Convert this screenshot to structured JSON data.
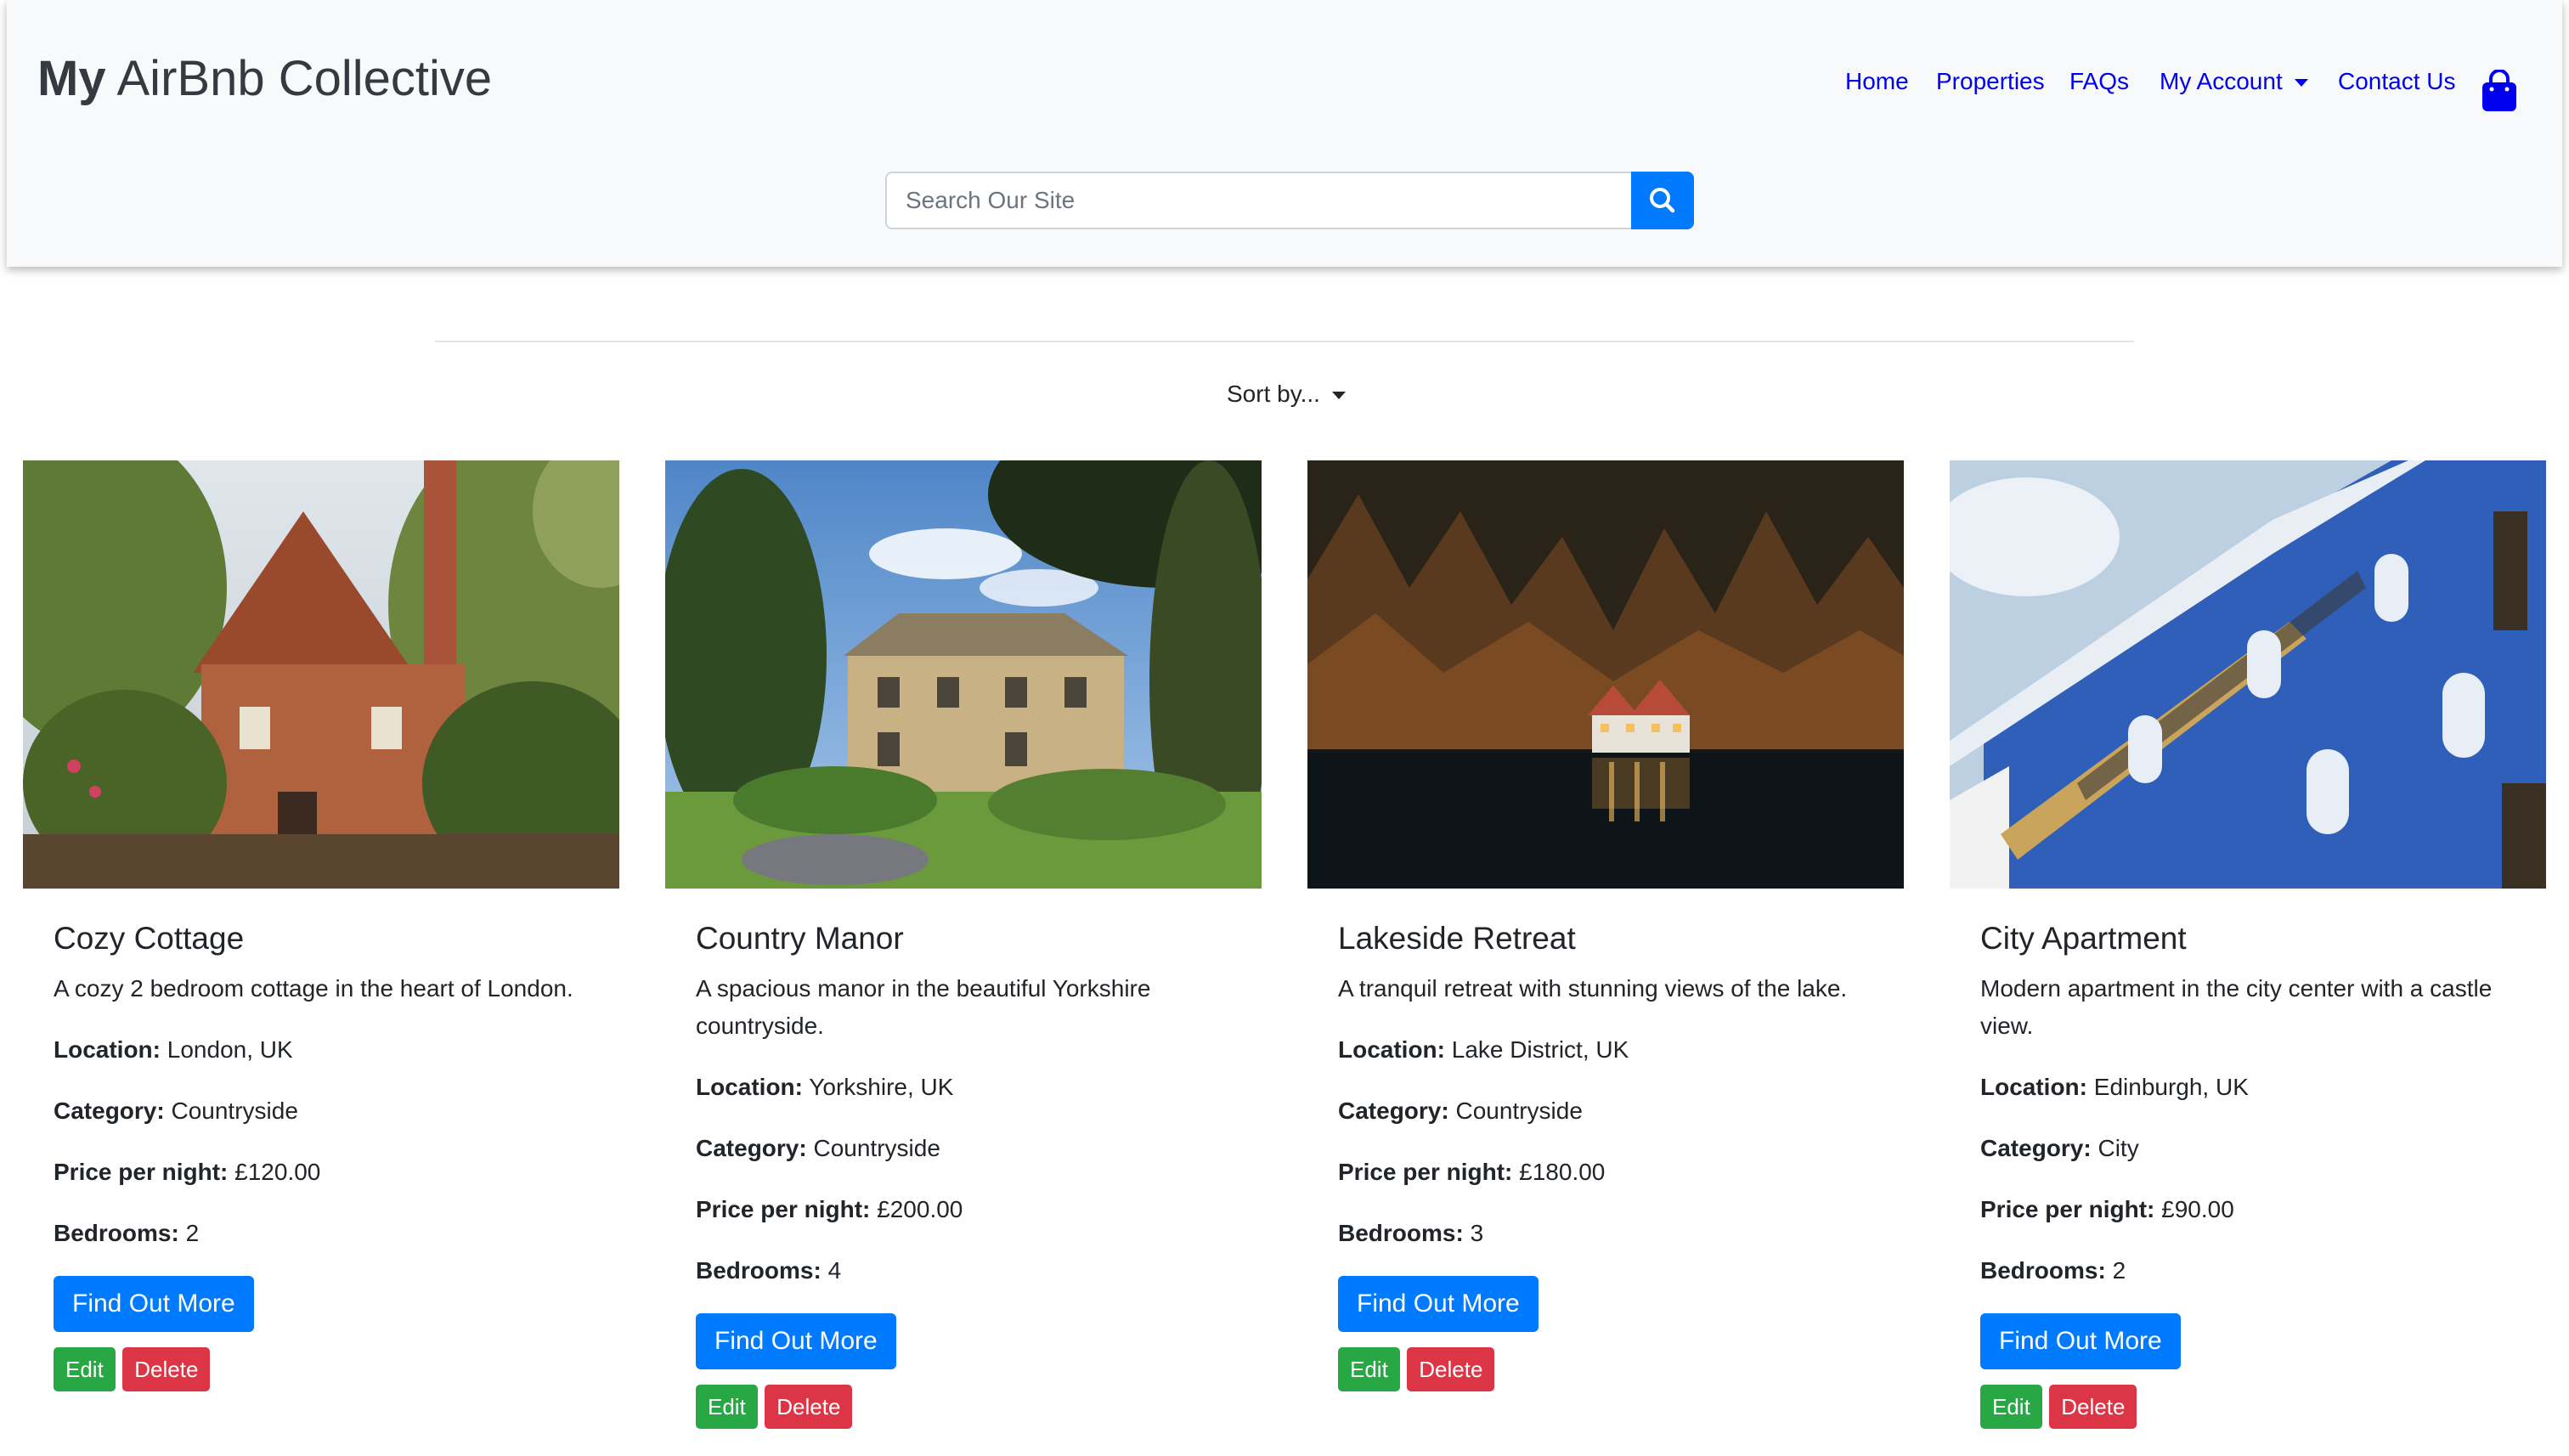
{
  "brand": {
    "bold": "My",
    "rest": " AirBnb Collective"
  },
  "nav": {
    "home": "Home",
    "properties": "Properties",
    "faqs": "FAQs",
    "account": "My Account",
    "contact": "Contact Us"
  },
  "search": {
    "placeholder": "Search Our Site"
  },
  "sort": {
    "label": "Sort by..."
  },
  "labels": {
    "location": "Location:",
    "category": "Category:",
    "price": "Price per night:",
    "bedrooms": "Bedrooms:",
    "find_out_more": "Find Out More",
    "edit": "Edit",
    "delete": "Delete"
  },
  "properties": [
    {
      "title": "Cozy Cottage",
      "description": "A cozy 2 bedroom cottage in the heart of London.",
      "location": "London, UK",
      "category": "Countryside",
      "price": "£120.00",
      "bedrooms": "2"
    },
    {
      "title": "Country Manor",
      "description": "A spacious manor in the beautiful Yorkshire countryside.",
      "location": "Yorkshire, UK",
      "category": "Countryside",
      "price": "£200.00",
      "bedrooms": "4"
    },
    {
      "title": "Lakeside Retreat",
      "description": "A tranquil retreat with stunning views of the lake.",
      "location": "Lake District, UK",
      "category": "Countryside",
      "price": "£180.00",
      "bedrooms": "3"
    },
    {
      "title": "City Apartment",
      "description": "Modern apartment in the city center with a castle view.",
      "location": "Edinburgh, UK",
      "category": "City",
      "price": "£90.00",
      "bedrooms": "2"
    }
  ],
  "colors": {
    "primary": "#007bff",
    "success": "#28a745",
    "danger": "#dc3545",
    "nav_link": "#0000ee",
    "navbar_bg": "#f8f9fa"
  }
}
